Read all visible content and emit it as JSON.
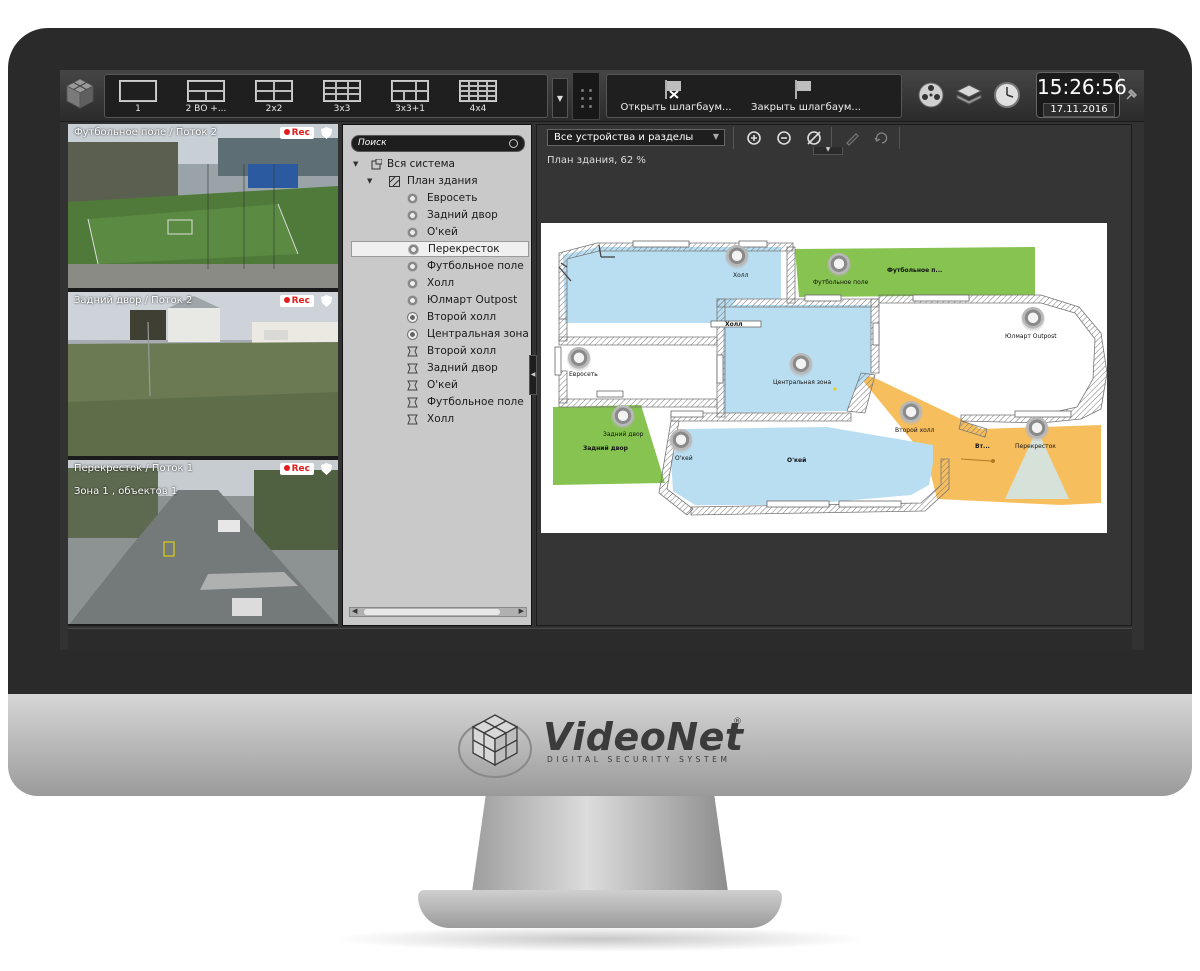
{
  "brand": {
    "name": "VideoNet",
    "tagline": "DIGITAL SECURITY SYSTEM",
    "reg": "®"
  },
  "toolbar": {
    "layouts": [
      {
        "label": "1",
        "cols": 1,
        "rows": 1
      },
      {
        "label": "2 ВО +...",
        "cols": 2,
        "rows": 2
      },
      {
        "label": "2x2",
        "cols": 2,
        "rows": 2
      },
      {
        "label": "3x3",
        "cols": 3,
        "rows": 3
      },
      {
        "label": "3x3+1",
        "cols": 3,
        "rows": 2
      },
      {
        "label": "4x4",
        "cols": 4,
        "rows": 4
      }
    ],
    "barrier_open": "Открыть шлагбаум...",
    "barrier_close": "Закрыть шлагбаум...",
    "icons": [
      "film-reel-icon",
      "layers-icon",
      "clock-icon"
    ]
  },
  "clock": {
    "time": "15:26:56",
    "date": "17.11.2016"
  },
  "cameras": [
    {
      "title": "Футбольное поле / Поток 2",
      "rec": "Rec",
      "subtitle": ""
    },
    {
      "title": "Задний двор / Поток 2",
      "rec": "Rec",
      "subtitle": ""
    },
    {
      "title": "Перекресток / Поток 1",
      "rec": "Rec",
      "subtitle": "Зона 1 , объектов 1"
    }
  ],
  "tree": {
    "search_placeholder": "Поиск",
    "items": [
      {
        "label": "Вся система",
        "kind": "root"
      },
      {
        "label": "План здания",
        "kind": "plan"
      },
      {
        "label": "Евросеть",
        "kind": "dome"
      },
      {
        "label": "Задний двор",
        "kind": "dome"
      },
      {
        "label": "О'кей",
        "kind": "dome"
      },
      {
        "label": "Перекресток",
        "kind": "dome",
        "selected": true
      },
      {
        "label": "Футбольное поле",
        "kind": "dome"
      },
      {
        "label": "Холл",
        "kind": "dome"
      },
      {
        "label": "Юлмарт Outpost",
        "kind": "dome"
      },
      {
        "label": "Второй холл",
        "kind": "ptz"
      },
      {
        "label": "Центральная зона",
        "kind": "ptz"
      },
      {
        "label": "Второй холл",
        "kind": "zone"
      },
      {
        "label": "Задний двор",
        "kind": "zone"
      },
      {
        "label": "О'кей",
        "kind": "zone"
      },
      {
        "label": "Футбольное поле",
        "kind": "zone"
      },
      {
        "label": "Холл",
        "kind": "zone"
      }
    ]
  },
  "map": {
    "scope": "Все устройства и разделы",
    "caption": "План здания, 62 %",
    "labels": {
      "hall": "Холл",
      "hall_zone": "Холл",
      "football": "Футбольное поле",
      "football_zone": "Футбольное п...",
      "yulmart": "Юлмарт Outpost",
      "evroset": "Евросеть",
      "central": "Центральная зона",
      "back_yard": "Задний двор",
      "back_yard_zone": "Задний двор",
      "okey_cam": "О'кей",
      "okey_zone": "О'кей",
      "second_hall": "Второй холл",
      "second_hall_zone": "Вт...",
      "crossroad": "Перекресток"
    },
    "colors": {
      "room": "#b9def2",
      "zone_green": "#86c350",
      "zone_orange": "#f7be5d",
      "wall": "#7a7a7a"
    }
  }
}
